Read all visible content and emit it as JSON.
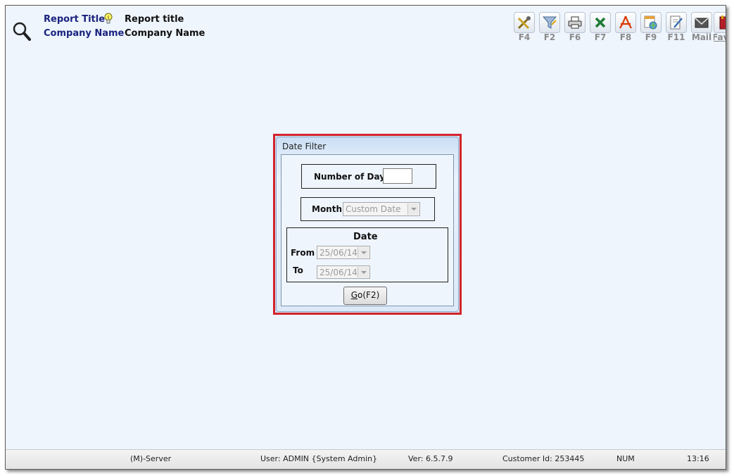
{
  "header": {
    "report_title_label": "Report Title",
    "report_title_value": "Report title",
    "company_name_label": "Company Name",
    "company_name_value": "Company Name"
  },
  "toolbar": {
    "buttons": [
      {
        "key": "F4",
        "icon": "settings-tools-icon"
      },
      {
        "key": "F2",
        "icon": "filter-icon"
      },
      {
        "key": "F6",
        "icon": "printer-icon"
      },
      {
        "key": "F7",
        "icon": "excel-icon"
      },
      {
        "key": "F8",
        "icon": "pdf-icon"
      },
      {
        "key": "F9",
        "icon": "web-export-icon"
      },
      {
        "key": "F11",
        "icon": "edit-note-icon"
      },
      {
        "key": "Mail",
        "icon": "mail-icon"
      },
      {
        "key": "Fav",
        "icon": "favorite-book-icon"
      }
    ]
  },
  "date_filter": {
    "title": "Date Filter",
    "number_of_day_label": "Number of Day",
    "number_of_day_value": "",
    "month_label": "Month",
    "month_value": "Custom Date",
    "date_heading": "Date",
    "from_label": "From",
    "from_value": "25/06/14",
    "to_label": "To",
    "to_value": "25/06/14",
    "go_prefix": "G",
    "go_rest": "o(F2)"
  },
  "statusbar": {
    "server": "(M)-Server",
    "user": "User: ADMIN {System Admin}",
    "version": "Ver: 6.5.7.9",
    "customer": "Customer Id: 253445",
    "num": "NUM",
    "time": "13:16"
  },
  "colors": {
    "background": "#eef5fd",
    "label_blue": "#1a237e",
    "highlight_red": "#d2232a"
  }
}
